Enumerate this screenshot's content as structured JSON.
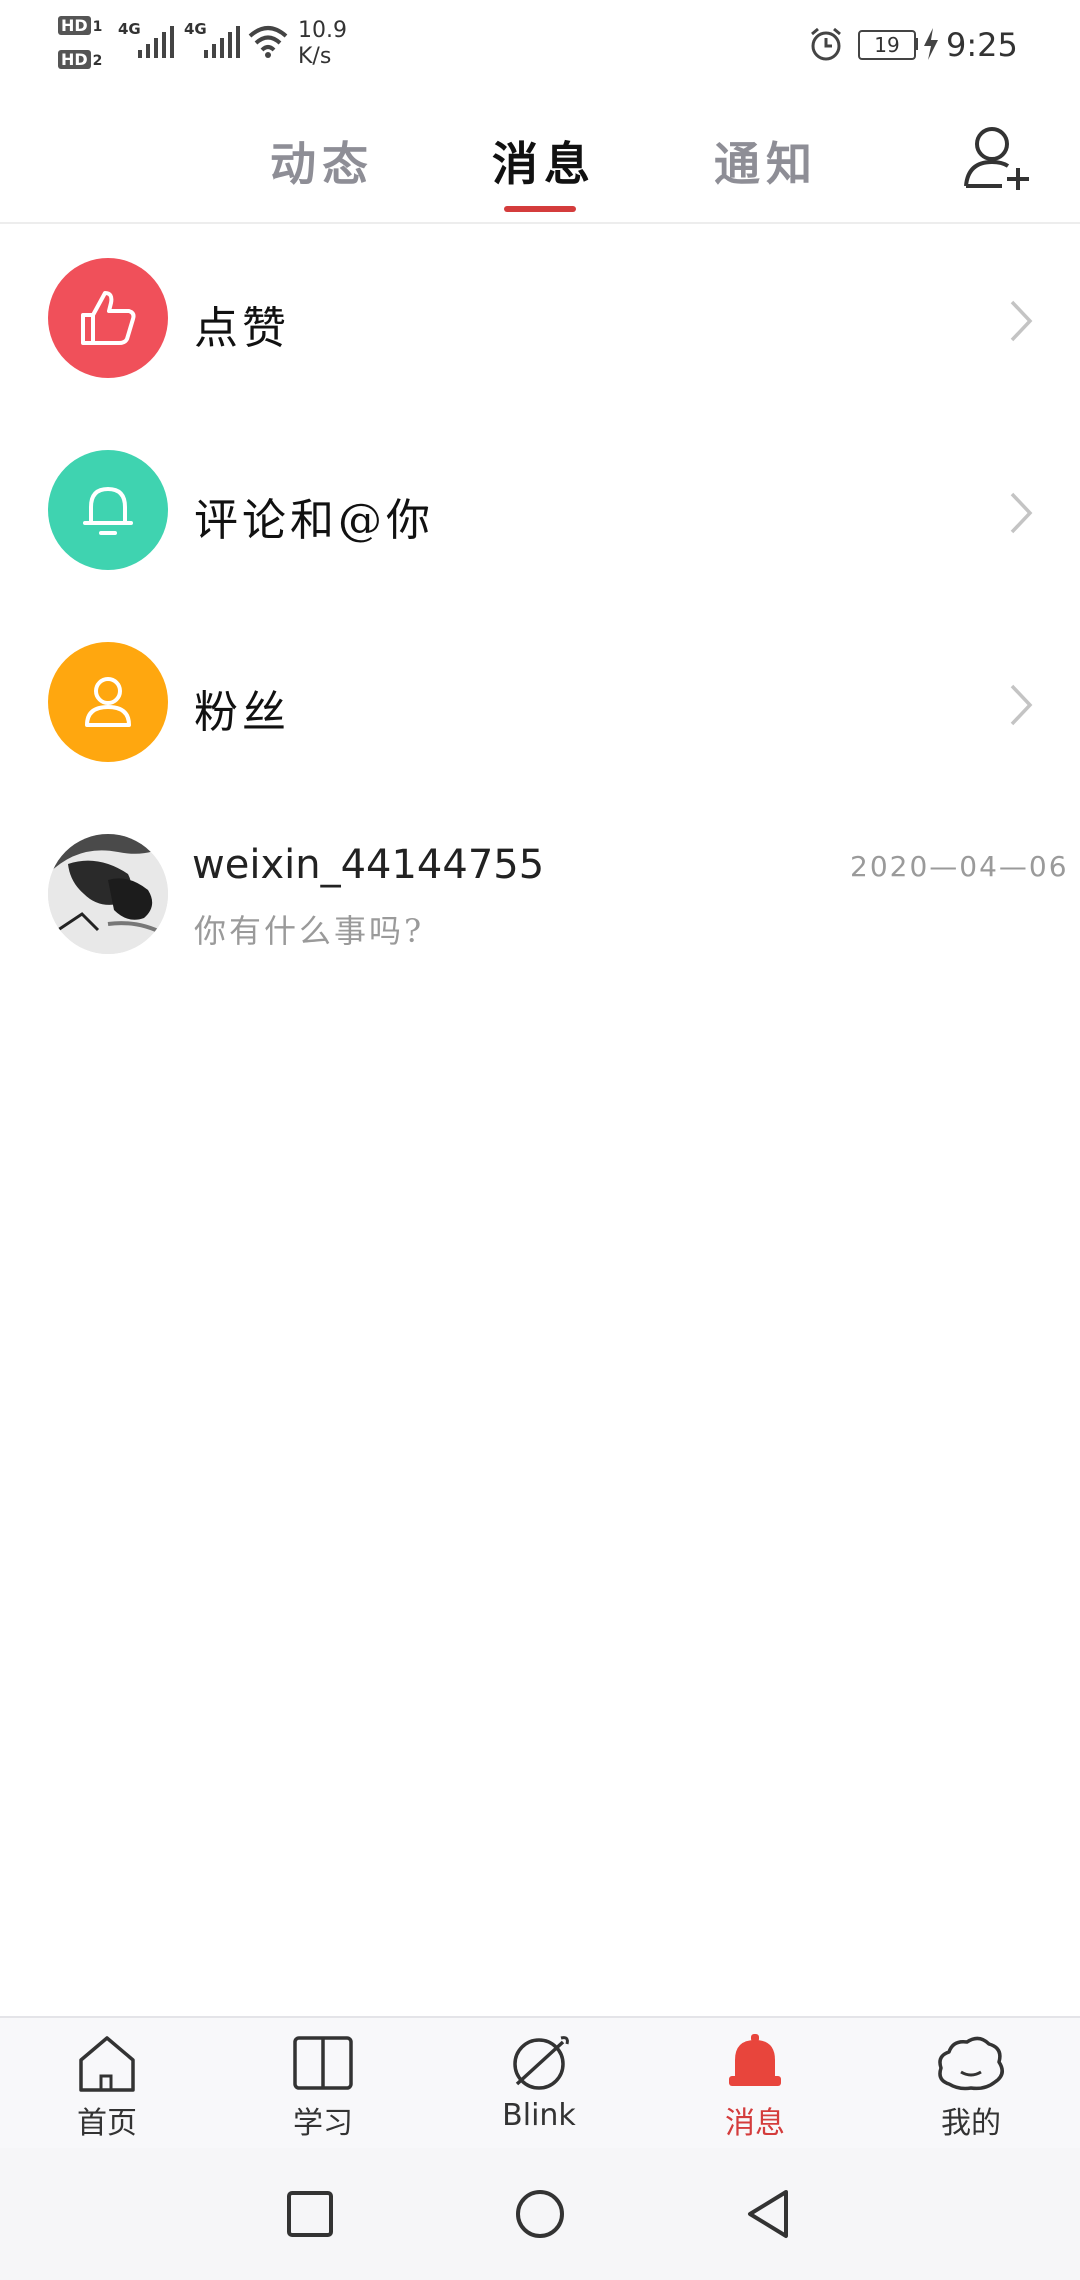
{
  "status_bar": {
    "hd1": "HD",
    "hd1_sub": "1",
    "hd2": "HD",
    "hd2_sub": "2",
    "net1": "4G",
    "net2": "4G",
    "speed_value": "10.9",
    "speed_unit": "K/s",
    "battery": "19",
    "time": "9:25",
    "icons": [
      "signal-icon",
      "wifi-icon",
      "alarm-icon",
      "battery-icon",
      "charging-icon"
    ]
  },
  "header": {
    "tabs": [
      {
        "label": "动态",
        "active": false
      },
      {
        "label": "消息",
        "active": true
      },
      {
        "label": "通知",
        "active": false
      }
    ],
    "add_friend_icon": "add-user-icon"
  },
  "list": {
    "items": [
      {
        "label": "点赞",
        "icon": "thumbs-up-icon",
        "color": "#f0505a"
      },
      {
        "label": "评论和@你",
        "icon": "bell-icon",
        "color": "#3fd3b0"
      },
      {
        "label": "粉丝",
        "icon": "person-icon",
        "color": "#ffa70f"
      }
    ]
  },
  "conversation": {
    "username": "weixin_44144755",
    "preview": "你有什么事吗?",
    "date": "2020—04—06",
    "avatar_icon": "avatar"
  },
  "bottom_nav": {
    "items": [
      {
        "label": "首页",
        "icon": "home-icon",
        "active": false
      },
      {
        "label": "学习",
        "icon": "book-icon",
        "active": false
      },
      {
        "label": "Blink",
        "icon": "planet-icon",
        "active": false
      },
      {
        "label": "消息",
        "icon": "bell-icon",
        "active": true
      },
      {
        "label": "我的",
        "icon": "profile-icon",
        "active": false
      }
    ],
    "active_color": "#d43c3c"
  },
  "system_nav": {
    "icons": [
      "recent-apps-icon",
      "home-circle-icon",
      "back-icon"
    ]
  }
}
